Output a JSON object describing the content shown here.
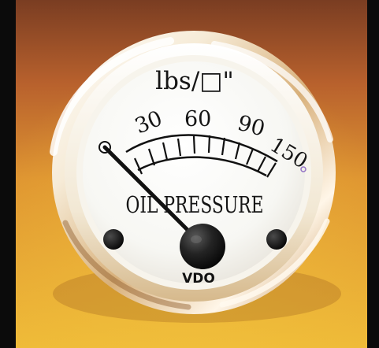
{
  "gauge": {
    "unit_label": "lbs/□\"",
    "scale_labels": [
      "30",
      "60",
      "90",
      "150"
    ],
    "title": "OIL PRESSURE",
    "brand": "VDO",
    "reading": "0"
  }
}
